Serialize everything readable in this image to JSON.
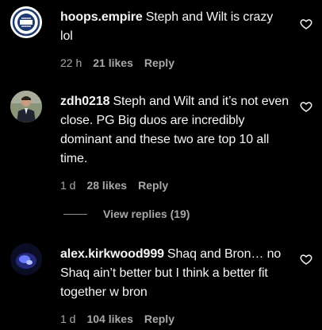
{
  "comments": [
    {
      "username": "hoops.empire",
      "text": "Steph and Wilt is crazy lol",
      "time": "22 h",
      "likes": "21 likes",
      "reply": "Reply",
      "avatar": "hoops-empire-logo"
    },
    {
      "username": "zdh0218",
      "text": "Steph and Wilt and it’s not even close. PG Big duos are incredibly dominant and these two are top 10 all time.",
      "time": "1 d",
      "likes": "28 likes",
      "reply": "Reply",
      "avatar": "person-in-suit"
    },
    {
      "username": "alex.kirkwood999",
      "text": "Shaq and Bron… no Shaq ain’t better but I think a better fit together w bron",
      "time": "1 d",
      "likes": "104 likes",
      "reply": "Reply",
      "avatar": "blue-lit-portrait"
    }
  ],
  "view_replies": "View replies (19)",
  "icons": {
    "like": "heart-outline-icon"
  },
  "colors": {
    "background": "#000000",
    "text": "#f5f5f5",
    "meta": "#a8a8a8"
  }
}
